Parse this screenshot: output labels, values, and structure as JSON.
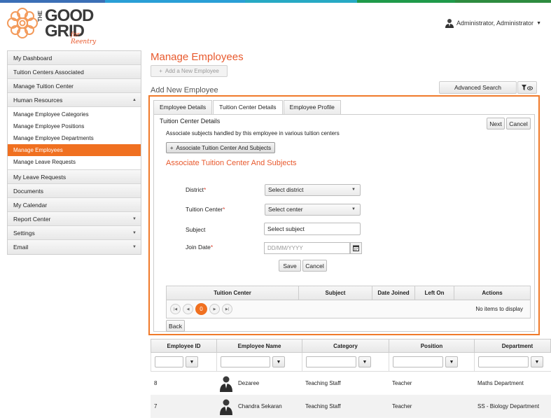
{
  "brand": {
    "the": "THE",
    "good": "GOOD",
    "grid": "GRID",
    "tagline": "for Reentry",
    "colors": {
      "petal": "#f39a5a",
      "text": "#3a3a3a",
      "accent": "#e8592d"
    }
  },
  "topbar_colors": [
    "#3b6fb6",
    "#2a9fd6",
    "#27a9c4",
    "#1f9a4a",
    "#2e8b3f"
  ],
  "user": {
    "name": "Administrator, Administrator",
    "icon": "user-avatar-icon"
  },
  "sidebar": {
    "items": [
      {
        "label": "My Dashboard"
      },
      {
        "label": "Tuition Centers Associated"
      },
      {
        "label": "Manage Tuition Center"
      },
      {
        "label": "Human Resources",
        "expanded": true
      },
      {
        "label": "My Leave Requests"
      },
      {
        "label": "Documents"
      },
      {
        "label": "My Calendar"
      },
      {
        "label": "Report Center",
        "arrow": "▼"
      },
      {
        "label": "Settings",
        "arrow": "▼"
      },
      {
        "label": "Email",
        "arrow": "▼"
      }
    ],
    "hr_arrow": "▲",
    "hr_children": [
      "Manage Employee Categories",
      "Manage Employee Positions",
      "Manage Employee Departments",
      "Manage Employees",
      "Manage Leave Requests"
    ],
    "active_child": "Manage Employees"
  },
  "main": {
    "title": "Manage Employees",
    "add_button": "Add a New Employee",
    "add_new_label": "Add New Employee",
    "advanced_search": "Advanced Search"
  },
  "tabs": [
    "Employee Details",
    "Tuition Center Details",
    "Employee Profile"
  ],
  "active_tab": "Tuition Center Details",
  "tuition": {
    "title": "Tuition Center Details",
    "next": "Next",
    "cancel": "Cancel",
    "description": "Associate subjects handled by this employee in various tuition centers",
    "assoc_button": "Associate Tuition Center And Subjects",
    "assoc_heading": "Associate Tuition Center And Subjects",
    "form": {
      "district_label": "District",
      "district_value": "Select district",
      "center_label": "Tuition Center",
      "center_value": "Select center",
      "subject_label": "Subject",
      "subject_value": "Select subject",
      "join_label": "Join Date",
      "join_placeholder": "DD/MM/YYYY",
      "required_mark": "*",
      "save": "Save",
      "cancel": "Cancel"
    },
    "grid": {
      "columns": [
        "Tuition Center",
        "Subject",
        "Date Joined",
        "Left On",
        "Actions"
      ],
      "current_page": "0",
      "empty_text": "No items to display"
    },
    "back": "Back"
  },
  "employees": {
    "columns": [
      "Employee ID",
      "Employee Name",
      "Category",
      "Position",
      "Department"
    ],
    "rows": [
      {
        "id": "8",
        "name": "Dezaree",
        "category": "Teaching Staff",
        "position": "Teacher",
        "department": "Maths Department"
      },
      {
        "id": "7",
        "name": "Chandra Sekaran",
        "category": "Teaching Staff",
        "position": "Teacher",
        "department": "SS - Biology Department"
      }
    ]
  }
}
